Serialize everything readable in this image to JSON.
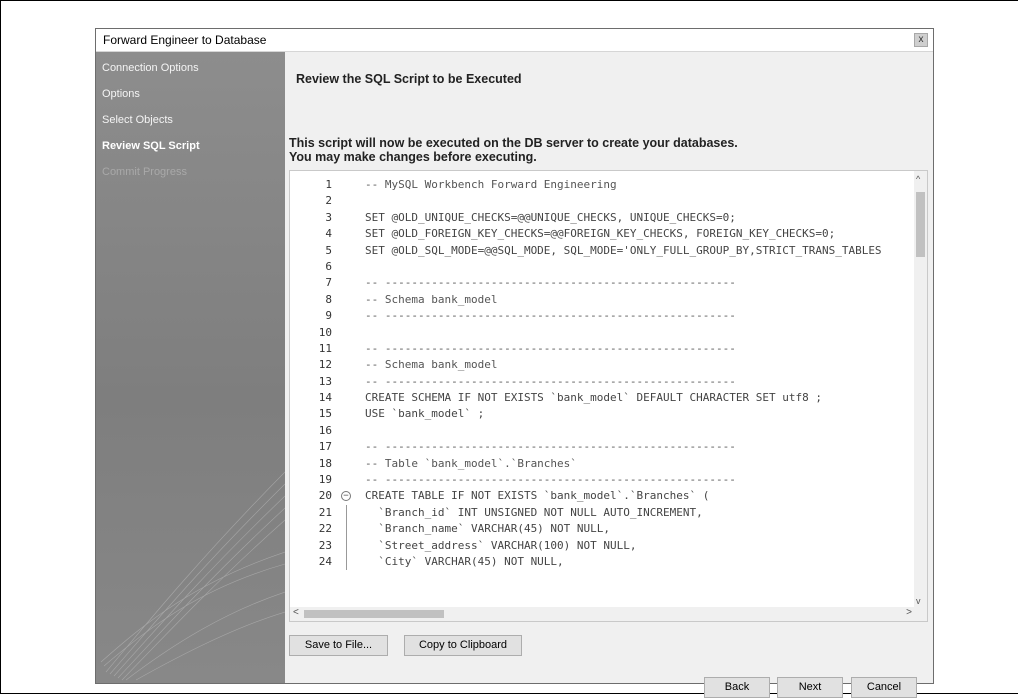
{
  "window": {
    "title": "Forward Engineer to Database",
    "close_glyph": "x"
  },
  "sidebar": {
    "items": [
      {
        "label": "Connection Options"
      },
      {
        "label": "Options"
      },
      {
        "label": "Select Objects"
      },
      {
        "label": "Review SQL Script"
      },
      {
        "label": "Commit Progress"
      }
    ]
  },
  "main": {
    "header": "Review the SQL Script to be Executed",
    "description_line1": "This script will now be executed on the DB server to create your databases.",
    "description_line2": "You may make changes before executing."
  },
  "editor": {
    "lines": [
      {
        "n": "1",
        "text": "-- MySQL Workbench Forward Engineering"
      },
      {
        "n": "2",
        "text": ""
      },
      {
        "n": "3",
        "text": "SET @OLD_UNIQUE_CHECKS=@@UNIQUE_CHECKS, UNIQUE_CHECKS=0;"
      },
      {
        "n": "4",
        "text": "SET @OLD_FOREIGN_KEY_CHECKS=@@FOREIGN_KEY_CHECKS, FOREIGN_KEY_CHECKS=0;"
      },
      {
        "n": "5",
        "text": "SET @OLD_SQL_MODE=@@SQL_MODE, SQL_MODE='ONLY_FULL_GROUP_BY,STRICT_TRANS_TABLES"
      },
      {
        "n": "6",
        "text": ""
      },
      {
        "n": "7",
        "text": "-- -----------------------------------------------------"
      },
      {
        "n": "8",
        "text": "-- Schema bank_model"
      },
      {
        "n": "9",
        "text": "-- -----------------------------------------------------"
      },
      {
        "n": "10",
        "text": ""
      },
      {
        "n": "11",
        "text": "-- -----------------------------------------------------"
      },
      {
        "n": "12",
        "text": "-- Schema bank_model"
      },
      {
        "n": "13",
        "text": "-- -----------------------------------------------------"
      },
      {
        "n": "14",
        "text": "CREATE SCHEMA IF NOT EXISTS `bank_model` DEFAULT CHARACTER SET utf8 ;"
      },
      {
        "n": "15",
        "text": "USE `bank_model` ;"
      },
      {
        "n": "16",
        "text": ""
      },
      {
        "n": "17",
        "text": "-- -----------------------------------------------------"
      },
      {
        "n": "18",
        "text": "-- Table `bank_model`.`Branches`"
      },
      {
        "n": "19",
        "text": "-- -----------------------------------------------------"
      },
      {
        "n": "20",
        "text": "CREATE TABLE IF NOT EXISTS `bank_model`.`Branches` ("
      },
      {
        "n": "21",
        "text": "  `Branch_id` INT UNSIGNED NOT NULL AUTO_INCREMENT,"
      },
      {
        "n": "22",
        "text": "  `Branch_name` VARCHAR(45) NOT NULL,"
      },
      {
        "n": "23",
        "text": "  `Street_address` VARCHAR(100) NOT NULL,"
      },
      {
        "n": "24",
        "text": "  `City` VARCHAR(45) NOT NULL,"
      }
    ],
    "fold_glyph": "−",
    "scroll_up": "^",
    "scroll_down": "v",
    "scroll_left": "<",
    "scroll_right": ">"
  },
  "buttons": {
    "save_to_file": "Save to File...",
    "copy_to_clipboard": "Copy to Clipboard",
    "back": "Back",
    "next": "Next",
    "cancel": "Cancel"
  }
}
